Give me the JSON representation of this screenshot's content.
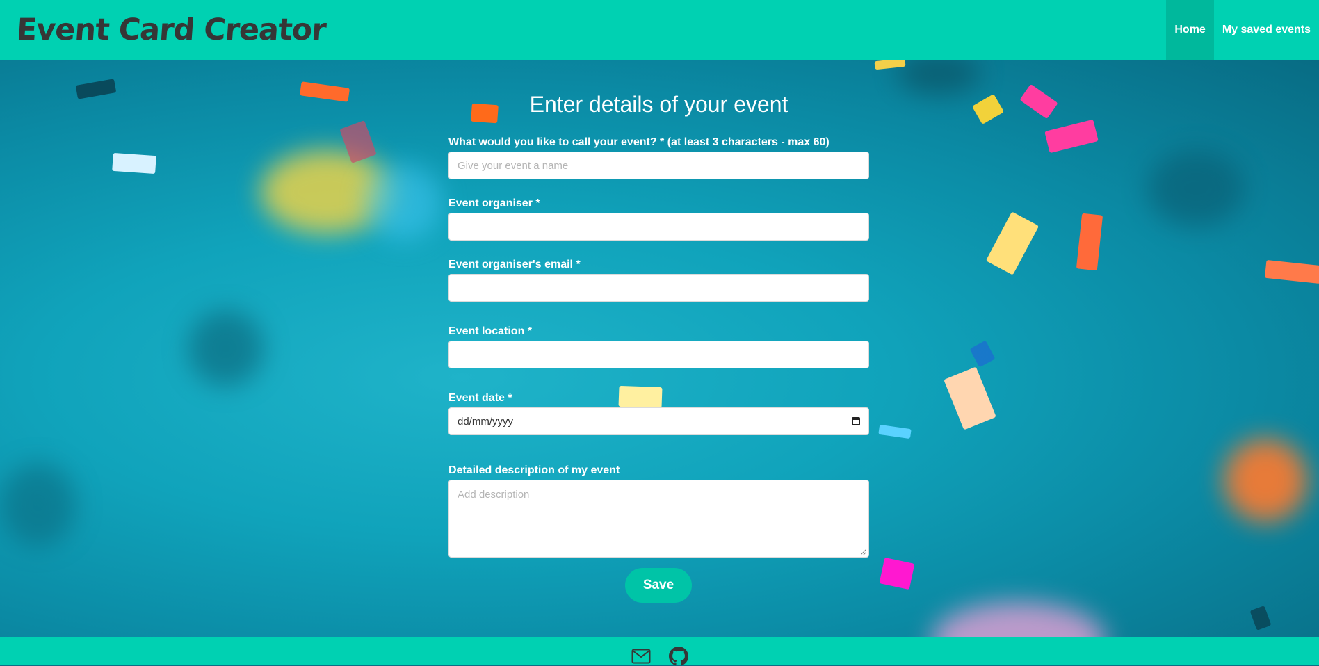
{
  "header": {
    "brand": "Event Card Creator",
    "nav": [
      {
        "label": "Home",
        "active": true
      },
      {
        "label": "My saved events",
        "active": false
      }
    ]
  },
  "form": {
    "title": "Enter details of your event",
    "fields": {
      "name": {
        "label": "What would you like to call your event? * (at least 3 characters - max 60)",
        "placeholder": "Give your event a name",
        "value": ""
      },
      "organiser": {
        "label": "Event organiser *",
        "value": ""
      },
      "email": {
        "label": "Event organiser's email *",
        "value": ""
      },
      "location": {
        "label": "Event location *",
        "value": ""
      },
      "date": {
        "label": "Event date *",
        "value": "dd/mm/yyyy"
      },
      "description": {
        "label": "Detailed description of my event",
        "placeholder": "Add description"
      }
    },
    "save_label": "Save"
  },
  "footer": {
    "icons": [
      "mail-icon",
      "github-icon"
    ]
  },
  "colors": {
    "primary": "#00d1b2",
    "button": "#00c4a7",
    "brand_text": "#363636"
  }
}
